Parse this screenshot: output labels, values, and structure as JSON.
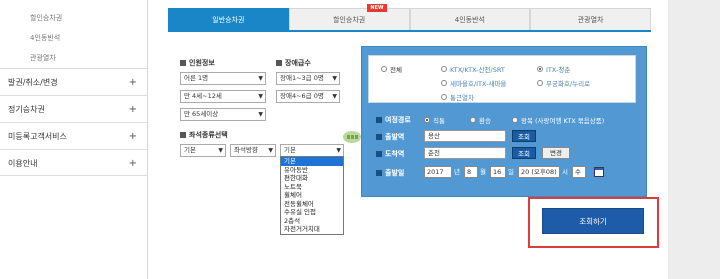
{
  "sidebar": {
    "sub_items": [
      "할인승차권",
      "4인동반석",
      "관광열차"
    ],
    "menu_items": [
      {
        "label": "발권/취소/변경",
        "expand": "+"
      },
      {
        "label": "정기승차권",
        "expand": "+"
      },
      {
        "label": "미등록고객서비스",
        "expand": "+"
      },
      {
        "label": "이용안내",
        "expand": "+"
      }
    ]
  },
  "tabs": [
    {
      "label": "일반승차권",
      "active": true
    },
    {
      "label": "할인승차권",
      "badge": "NEW"
    },
    {
      "label": "4인동반석"
    },
    {
      "label": "관광열차"
    }
  ],
  "passengers": {
    "title": "인원정보",
    "adult": "어른 1명",
    "child": "만 4세~12세",
    "senior": "만 65세이상"
  },
  "disabled": {
    "title": "장애급수",
    "grade13": "장애1~3급 0명",
    "grade46": "장애4~6급 0명"
  },
  "seat_type": {
    "title": "좌석종류선택",
    "seat": "기본",
    "direction": "좌석방향",
    "type": "기본"
  },
  "dropdown": {
    "options": [
      "기본",
      "유아동반",
      "편한대화",
      "노트북",
      "휠체어",
      "전동휠체어",
      "수유실 인접",
      "2층석",
      "자전거거치대"
    ],
    "highlighted": "기본"
  },
  "train_type": {
    "options": [
      {
        "label": "전체",
        "selected": false,
        "dark": true
      },
      {
        "label": "KTX/KTX-산천/SRT",
        "selected": false
      },
      {
        "label": "ITX-청춘",
        "selected": true
      },
      {
        "label": "새마을호/ITX-새마을",
        "selected": false
      },
      {
        "label": "무궁화호/누리로",
        "selected": false
      },
      {
        "label": "통근열차",
        "selected": false
      }
    ]
  },
  "route": {
    "trip_label": "여정경로",
    "trip_options": [
      {
        "label": "직통",
        "selected": true
      },
      {
        "label": "환승",
        "selected": false
      },
      {
        "label": "왕복 (사랑여행 KTX 묶음상품)",
        "selected": false
      }
    ],
    "departure_label": "출발역",
    "departure_value": "용산",
    "arrival_label": "도착역",
    "arrival_value": "춘천",
    "search_label": "조회",
    "swap_label": "변경"
  },
  "date": {
    "label": "출발일",
    "year": "2017",
    "year_unit": "년",
    "month": "8",
    "month_unit": "월",
    "day": "16",
    "day_unit": "일",
    "hour": "20 (오후08)",
    "hour_unit": "시",
    "weekday": "수"
  },
  "submit": {
    "label": "조회하기"
  }
}
